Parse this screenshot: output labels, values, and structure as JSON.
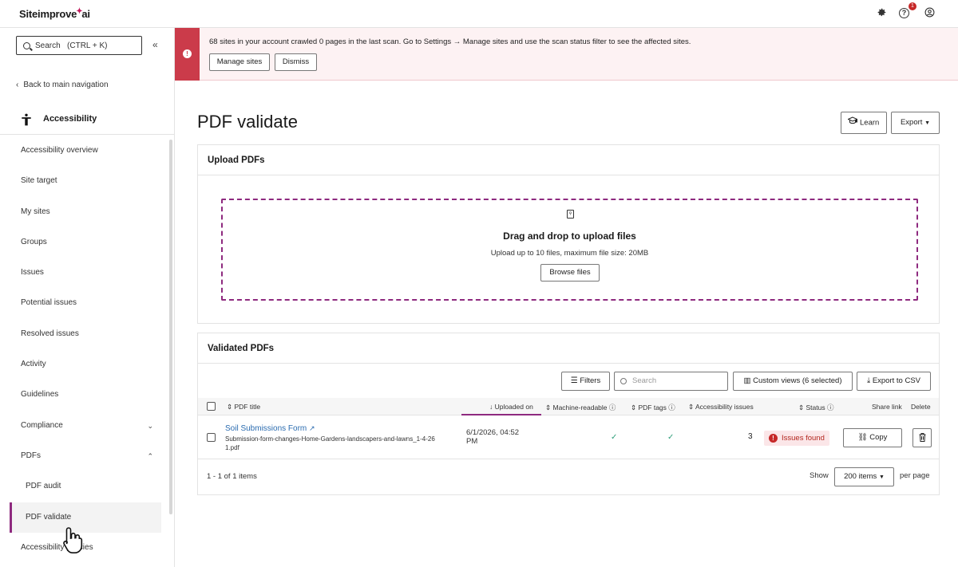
{
  "app": {
    "logo_text": "Siteimprove",
    "logo_spark": "✦",
    "logo_suffix": "ai",
    "notification_count": "1"
  },
  "sidebar": {
    "search_label": "Search",
    "search_shortcut": "(CTRL + K)",
    "collapse_glyph": "«",
    "back_label": "Back to main navigation",
    "section_title": "Accessibility",
    "items": [
      {
        "label": "Accessibility overview"
      },
      {
        "label": "Site target"
      },
      {
        "label": "My sites"
      },
      {
        "label": "Groups"
      },
      {
        "label": "Issues"
      },
      {
        "label": "Potential issues"
      },
      {
        "label": "Resolved issues"
      },
      {
        "label": "Activity"
      },
      {
        "label": "Guidelines"
      },
      {
        "label": "Compliance"
      },
      {
        "label": "PDFs"
      },
      {
        "label": "PDF audit"
      },
      {
        "label": "PDF validate"
      },
      {
        "label": "Accessibility policies"
      }
    ]
  },
  "alert": {
    "message": "68 sites in your account crawled 0 pages in the last scan. Go to Settings → Manage sites and use the scan status filter to see the affected sites.",
    "manage_label": "Manage sites",
    "dismiss_label": "Dismiss"
  },
  "page": {
    "title": "PDF validate",
    "learn_label": "Learn",
    "export_label": "Export"
  },
  "upload": {
    "heading": "Upload PDFs",
    "drop_title": "Drag and drop to upload files",
    "drop_sub": "Upload up to 10 files, maximum file size: 20MB",
    "browse_label": "Browse files"
  },
  "validated": {
    "heading": "Validated PDFs",
    "filters_label": "Filters",
    "search_placeholder": "Search",
    "custom_views_label": "Custom views (6 selected)",
    "export_csv_label": "Export to CSV",
    "columns": {
      "title": "PDF title",
      "uploaded": "Uploaded on",
      "machine": "Machine-readable",
      "tags": "PDF tags",
      "issues": "Accessibility issues",
      "status": "Status",
      "share": "Share link",
      "delete": "Delete"
    },
    "rows": [
      {
        "title": "Soil Submissions Form",
        "file_line1": "Submission-form-changes-Home-Gardens-landscapers-and-lawns_1-4-26",
        "file_line2": "1.pdf",
        "uploaded_line1": "6/1/2026, 04:52",
        "uploaded_line2": "PM",
        "issues": "3",
        "status": "Issues found",
        "copy_label": "Copy"
      }
    ],
    "footer": {
      "count": "1 - 1 of 1 items",
      "show": "Show",
      "page_size": "200 items",
      "per_page": "per page"
    }
  }
}
